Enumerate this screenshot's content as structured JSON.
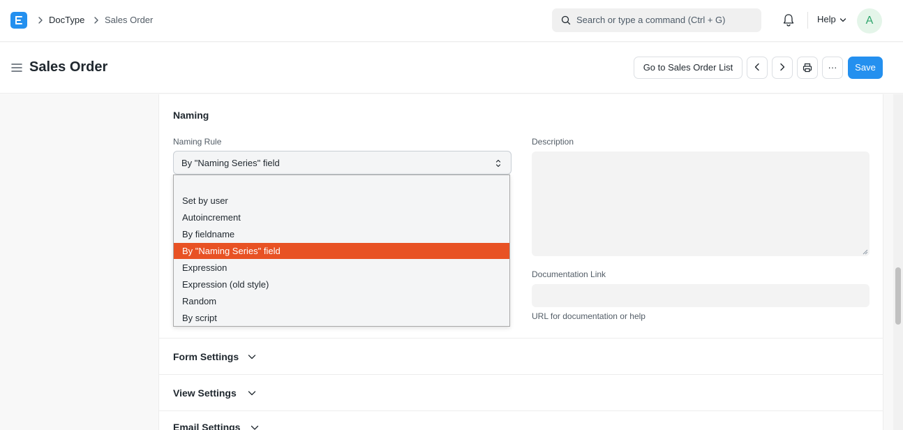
{
  "navbar": {
    "breadcrumbs": [
      "DocType",
      "Sales Order"
    ],
    "search_placeholder": "Search or type a command (Ctrl + G)",
    "help_label": "Help",
    "avatar_initial": "A"
  },
  "page": {
    "title": "Sales Order",
    "actions": {
      "list_button": "Go to Sales Order List",
      "more_label": "···",
      "save_label": "Save"
    }
  },
  "form": {
    "section_title": "Naming",
    "naming_rule": {
      "label": "Naming Rule",
      "value": "By \"Naming Series\" field",
      "options": [
        "",
        "Set by user",
        "Autoincrement",
        "By fieldname",
        "By \"Naming Series\" field",
        "Expression",
        "Expression (old style)",
        "Random",
        "By script"
      ],
      "selected_index": 4
    },
    "description": {
      "label": "Description"
    },
    "documentation_link": {
      "label": "Documentation Link",
      "help": "URL for documentation or help"
    },
    "collapsed_sections": [
      "Form Settings",
      "View Settings",
      "Email Settings"
    ]
  },
  "colors": {
    "primary": "#2490ef",
    "selected_option": "#e85224"
  }
}
